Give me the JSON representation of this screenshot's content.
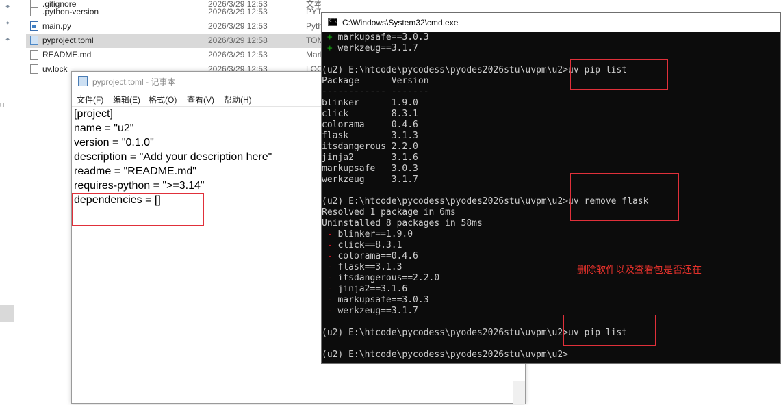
{
  "explorer": {
    "files": [
      {
        "name": ".gitignore",
        "date": "2026/3/29 12:53",
        "type": "文本文档",
        "icon": "file-icon"
      },
      {
        "name": ".python-version",
        "date": "2026/3/29 12:53",
        "type": "PYTHON-VERSI...",
        "icon": "file-icon"
      },
      {
        "name": "main.py",
        "date": "2026/3/29 12:53",
        "type": "Python",
        "icon": "python-file-icon"
      },
      {
        "name": "pyproject.toml",
        "date": "2026/3/29 12:58",
        "type": "TOML",
        "icon": "toml-file-icon"
      },
      {
        "name": "README.md",
        "date": "2026/3/29 12:53",
        "type": "Markdown",
        "icon": "file-icon"
      },
      {
        "name": "uv.lock",
        "date": "2026/3/29 12:53",
        "type": "LOCK",
        "icon": "file-icon"
      }
    ],
    "left_char": "u"
  },
  "notepad": {
    "title": "pyproject.toml - 记事本",
    "menu": [
      "文件(F)",
      "编辑(E)",
      "格式(O)",
      "查看(V)",
      "帮助(H)"
    ],
    "lines": [
      "[project]",
      "name = \"u2\"",
      "version = \"0.1.0\"",
      "description = \"Add your description here\"",
      "readme = \"README.md\"",
      "requires-python = \">=3.14\"",
      "dependencies = []"
    ]
  },
  "cmd": {
    "title": "C:\\Windows\\System32\\cmd.exe",
    "lines": [
      {
        "prefix": "+",
        "text": " markupsafe==3.0.3"
      },
      {
        "prefix": "+",
        "text": " werkzeug==3.1.7"
      },
      {
        "prefix": "",
        "text": ""
      },
      {
        "prefix": "",
        "text": "(u2) E:\\htcode\\pycodess\\pyodes2026stu\\uvpm\\u2>uv pip list"
      },
      {
        "prefix": "",
        "text": "Package      Version"
      },
      {
        "prefix": "",
        "text": "------------ -------"
      },
      {
        "prefix": "",
        "text": "blinker      1.9.0"
      },
      {
        "prefix": "",
        "text": "click        8.3.1"
      },
      {
        "prefix": "",
        "text": "colorama     0.4.6"
      },
      {
        "prefix": "",
        "text": "flask        3.1.3"
      },
      {
        "prefix": "",
        "text": "itsdangerous 2.2.0"
      },
      {
        "prefix": "",
        "text": "jinja2       3.1.6"
      },
      {
        "prefix": "",
        "text": "markupsafe   3.0.3"
      },
      {
        "prefix": "",
        "text": "werkzeug     3.1.7"
      },
      {
        "prefix": "",
        "text": ""
      },
      {
        "prefix": "",
        "text": "(u2) E:\\htcode\\pycodess\\pyodes2026stu\\uvpm\\u2>uv remove flask"
      },
      {
        "prefix": "",
        "text": "Resolved 1 package in 6ms"
      },
      {
        "prefix": "",
        "text": "Uninstalled 8 packages in 58ms"
      },
      {
        "prefix": "-",
        "text": " blinker==1.9.0"
      },
      {
        "prefix": "-",
        "text": " click==8.3.1"
      },
      {
        "prefix": "-",
        "text": " colorama==0.4.6"
      },
      {
        "prefix": "-",
        "text": " flask==3.1.3"
      },
      {
        "prefix": "-",
        "text": " itsdangerous==2.2.0"
      },
      {
        "prefix": "-",
        "text": " jinja2==3.1.6"
      },
      {
        "prefix": "-",
        "text": " markupsafe==3.0.3"
      },
      {
        "prefix": "-",
        "text": " werkzeug==3.1.7"
      },
      {
        "prefix": "",
        "text": ""
      },
      {
        "prefix": "",
        "text": "(u2) E:\\htcode\\pycodess\\pyodes2026stu\\uvpm\\u2>uv pip list"
      },
      {
        "prefix": "",
        "text": ""
      },
      {
        "prefix": "",
        "text": "(u2) E:\\htcode\\pycodess\\pyodes2026stu\\uvpm\\u2>"
      }
    ]
  },
  "annotation": "删除软件以及查看包是否还在",
  "colors": {
    "terminal_bg": "#0c0c0c",
    "terminal_text": "#cccccc",
    "plus": "#13a10e",
    "minus": "#c50f1f",
    "highlight_box": "#e0303a"
  }
}
